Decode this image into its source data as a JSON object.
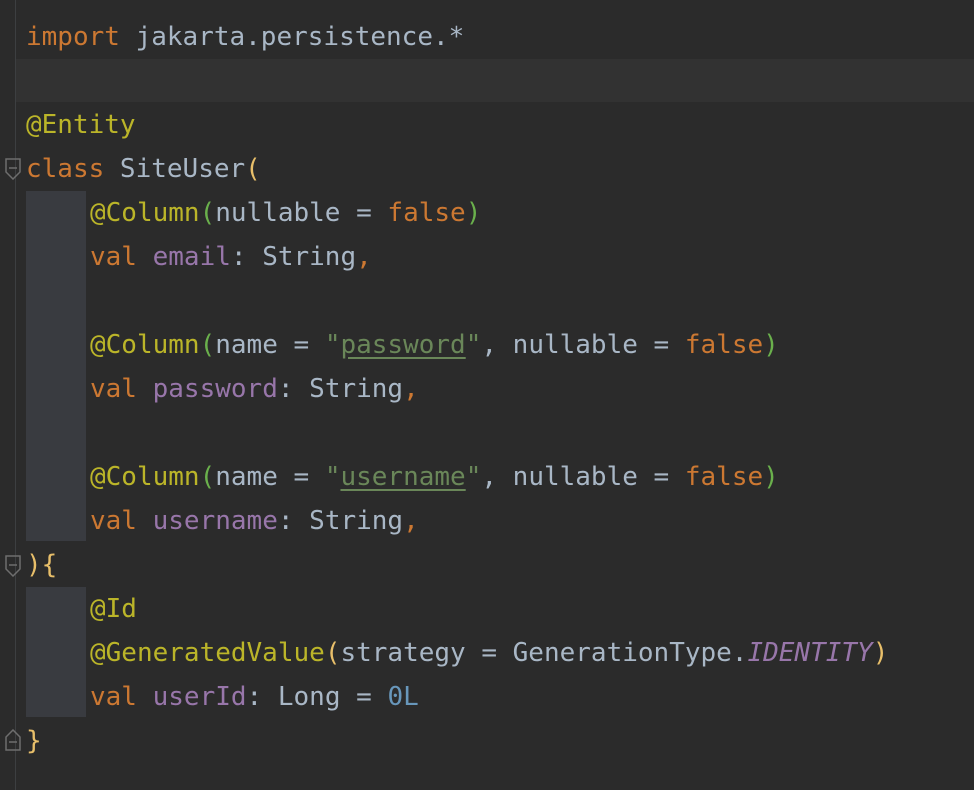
{
  "editor": {
    "lines": {
      "l1": {
        "kw": "import",
        "rest": " jakarta.persistence.*"
      },
      "l3": {
        "ann": "@Entity"
      },
      "l4": {
        "kw": "class",
        "name": " SiteUser",
        "open": "("
      },
      "l5": {
        "ann": "@Column",
        "open": "(",
        "arg": "nullable = ",
        "val": "false",
        "close": ")"
      },
      "l6": {
        "kw": "val",
        "prop": " email",
        "type": ": String",
        "comma": ","
      },
      "l8": {
        "ann": "@Column",
        "open": "(",
        "arg1": "name = ",
        "q1": "\"",
        "str": "password",
        "q2": "\"",
        "mid": ", nullable = ",
        "val": "false",
        "close": ")"
      },
      "l9": {
        "kw": "val",
        "prop": " password",
        "type": ": String",
        "comma": ","
      },
      "l11": {
        "ann": "@Column",
        "open": "(",
        "arg1": "name = ",
        "q1": "\"",
        "str": "username",
        "q2": "\"",
        "mid": ", nullable = ",
        "val": "false",
        "close": ")"
      },
      "l12": {
        "kw": "val",
        "prop": " username",
        "type": ": String",
        "comma": ","
      },
      "l13": {
        "close": ")",
        "brace": "{"
      },
      "l14": {
        "ann": "@Id"
      },
      "l15": {
        "ann": "@GeneratedValue",
        "open": "(",
        "arg": "strategy = GenerationType.",
        "const": "IDENTITY",
        "close": ")"
      },
      "l16": {
        "kw": "val",
        "prop": " userId",
        "type": ": Long = ",
        "num": "0L"
      },
      "l17": {
        "brace": "}"
      }
    }
  }
}
